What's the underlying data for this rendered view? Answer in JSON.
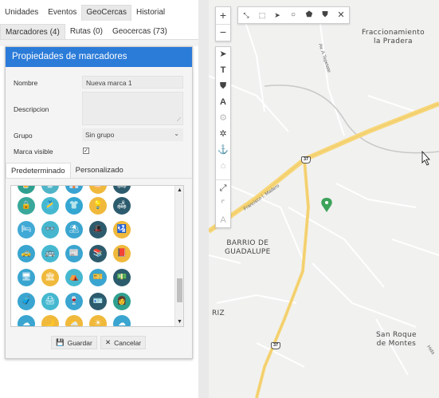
{
  "tabs_top": [
    "Unidades",
    "Eventos",
    "GeoCercas",
    "Historial"
  ],
  "tabs_top_active": 2,
  "tabs_sub": [
    "Marcadores (4)",
    "Rutas (0)",
    "Geocercas (73)"
  ],
  "modal": {
    "title": "Propiedades de marcadores",
    "fields": {
      "nombre_label": "Nombre",
      "nombre_value": "Nueva marca 1",
      "descripcion_label": "Descripcion",
      "grupo_label": "Grupo",
      "grupo_value": "Sin grupo",
      "marca_visible_label": "Marca visible",
      "marca_visible_checked": true
    },
    "icon_tabs": [
      "Predeterminado",
      "Personalizado"
    ],
    "icon_tab_active": 0,
    "icons": [
      {
        "name": "beer-icon",
        "color": "#2fa08f",
        "glyph": "🍺"
      },
      {
        "name": "tshirt-icon",
        "color": "#4fb4c7",
        "glyph": "👕"
      },
      {
        "name": "shirt-icon",
        "color": "#3aa3d1",
        "glyph": "👔"
      },
      {
        "name": "cake-icon",
        "color": "#f0b93c",
        "glyph": "🎂"
      },
      {
        "name": "sofa-icon",
        "color": "#2d5b6e",
        "glyph": "🛋"
      },
      {
        "name": "safe-icon",
        "color": "#39a89b",
        "glyph": "🔒"
      },
      {
        "name": "tank-top-icon",
        "color": "#45b8d0",
        "glyph": "🎽"
      },
      {
        "name": "tshirt-red-icon",
        "color": "#34a6d2",
        "glyph": "👕"
      },
      {
        "name": "lamp-icon",
        "color": "#f0b93c",
        "glyph": "💡"
      },
      {
        "name": "sofa-red-icon",
        "color": "#2c5b6d",
        "glyph": "🛋"
      },
      {
        "name": "bed-icon",
        "color": "#41a9d6",
        "glyph": "🛏"
      },
      {
        "name": "glasses-icon",
        "color": "#45b6ce",
        "glyph": "👓"
      },
      {
        "name": "umbrella-icon",
        "color": "#3aa5d0",
        "glyph": "⛱"
      },
      {
        "name": "hat-icon",
        "color": "#2d5b6e",
        "glyph": "🎩"
      },
      {
        "name": "passport-icon",
        "color": "#f0b93c",
        "glyph": "🛂"
      },
      {
        "name": "taxi-icon",
        "color": "#3aa5d0",
        "glyph": "🚕"
      },
      {
        "name": "bus-icon",
        "color": "#45b8d0",
        "glyph": "🚌"
      },
      {
        "name": "newspaper-icon",
        "color": "#3aa5d0",
        "glyph": "📰"
      },
      {
        "name": "books-icon",
        "color": "#2c5b6d",
        "glyph": "📚"
      },
      {
        "name": "book-icon",
        "color": "#f0b93c",
        "glyph": "📕"
      },
      {
        "name": "computer-icon",
        "color": "#3aa5d0",
        "glyph": "🖥"
      },
      {
        "name": "building-icon",
        "color": "#f0b93c",
        "glyph": "🏛"
      },
      {
        "name": "tent-icon",
        "color": "#45b8d0",
        "glyph": "⛺"
      },
      {
        "name": "ticket-icon",
        "color": "#3aa5d0",
        "glyph": "🎫"
      },
      {
        "name": "money-icon",
        "color": "#2c5b6d",
        "glyph": "💵"
      },
      {
        "name": "luggage-icon",
        "color": "#3aa5d0",
        "glyph": "🧳"
      },
      {
        "name": "printer-icon",
        "color": "#45b8d0",
        "glyph": "🖨"
      },
      {
        "name": "wine-icon",
        "color": "#3aa5d0",
        "glyph": "🍷"
      },
      {
        "name": "id-card-icon",
        "color": "#2c5b6d",
        "glyph": "🪪"
      },
      {
        "name": "nurse-icon",
        "color": "#2fa08f",
        "glyph": "👩"
      },
      {
        "name": "cloud-icon",
        "color": "#3aa5d0",
        "glyph": "☁"
      },
      {
        "name": "moon-cloud-icon",
        "color": "#f0b93c",
        "glyph": "🌙"
      },
      {
        "name": "sun-cloud-icon",
        "color": "#f0b93c",
        "glyph": "⛅"
      },
      {
        "name": "sun-icon",
        "color": "#f0b93c",
        "glyph": "☀"
      },
      {
        "name": "cloud-2-icon",
        "color": "#3aa5d0",
        "glyph": "☁"
      }
    ],
    "save_label": "Guardar",
    "cancel_label": "Cancelar"
  },
  "map": {
    "labels": {
      "fraccionamiento": "Fraccionamiento\nla Pradera",
      "barrio": "BARRIO DE\nGUADALUPE",
      "sanroque": "San Roque\nde Montes",
      "riz": "RIZ",
      "madero": "Francisco I. Madero",
      "tepetate": "Av. A Tepetate",
      "hida": "Hida"
    },
    "route_number": "37"
  },
  "colors": {
    "modal_header": "#2b7bd8",
    "highway": "#f7d679",
    "marker": "#3ea35a"
  }
}
